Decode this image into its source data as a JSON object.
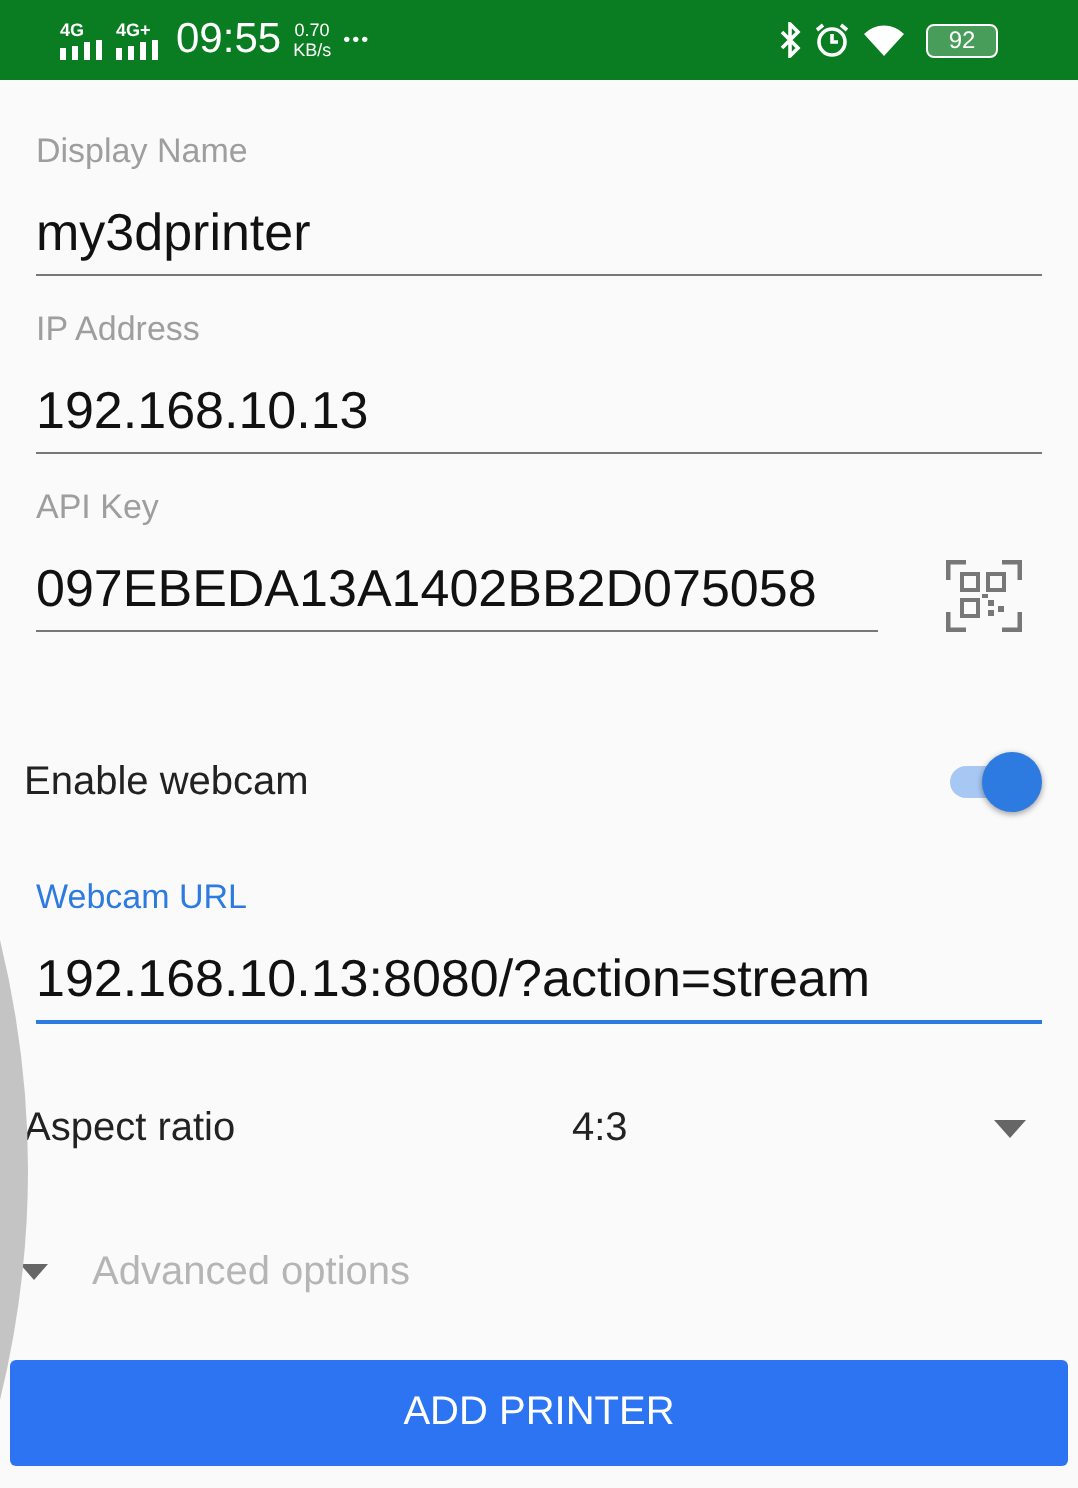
{
  "status_bar": {
    "signals": [
      "4G",
      "4G+"
    ],
    "time": "09:55",
    "speed": "0.70",
    "speed_unit": "KB/s",
    "more": "•••",
    "battery": "92"
  },
  "fields": [
    {
      "label": "Display Name",
      "value": "my3dprinter",
      "focused": false,
      "kind": "text"
    },
    {
      "label": "IP Address",
      "value": "192.168.10.13",
      "focused": false,
      "kind": "text"
    },
    {
      "label": "API Key",
      "value": "097EBEDA13A1402BB2D075058",
      "focused": false,
      "kind": "qr"
    }
  ],
  "webcam": {
    "label": "Enable webcam",
    "on": true
  },
  "webcam_url": {
    "label": "Webcam URL",
    "value": "192.168.10.13:8080/?action=stream",
    "focused": true
  },
  "aspect": {
    "label": "Aspect ratio",
    "value": "4:3"
  },
  "advanced": {
    "label": "Advanced options",
    "expanded": false
  },
  "button": "ADD PRINTER"
}
